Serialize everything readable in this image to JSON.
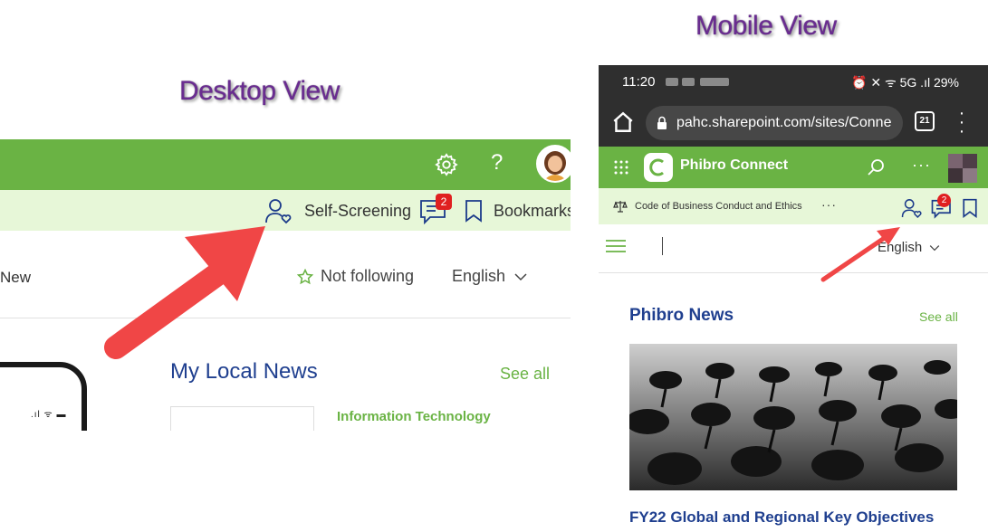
{
  "captions": {
    "desktop": "Desktop View",
    "mobile": "Mobile View"
  },
  "desktop": {
    "self_screening_label": "Self-Screening",
    "chat_badge": "2",
    "bookmarks_label": "Bookmarks",
    "new_label": "New",
    "follow_label": "Not following",
    "language": "English",
    "local_news_title": "My Local News",
    "see_all": "See all",
    "news_category": "Information Technology"
  },
  "mobile": {
    "time": "11:20",
    "battery": "29%",
    "url": "pahc.sharepoint.com/sites/Conne",
    "tab_count": "21",
    "site_name": "Phibro Connect",
    "code_link": "Code of Business Conduct and Ethics",
    "chat_badge": "2",
    "language": "English",
    "news_title": "Phibro News",
    "see_all": "See all",
    "headline": "FY22 Global and Regional Key Objectives"
  },
  "colors": {
    "brand_green": "#6ab344",
    "sub_bar": "#e7f7d8",
    "title_blue": "#1f3f8f",
    "caption_purple": "#6a2c91",
    "arrow_red": "#f04646",
    "badge_red": "#e02020"
  },
  "icons": [
    "gear-icon",
    "help-icon",
    "self-screening-icon",
    "chat-icon",
    "bookmark-icon",
    "star-icon",
    "chevron-down-icon",
    "home-icon",
    "lock-icon",
    "waffle-icon",
    "search-icon",
    "scale-icon",
    "hamburger-icon"
  ]
}
